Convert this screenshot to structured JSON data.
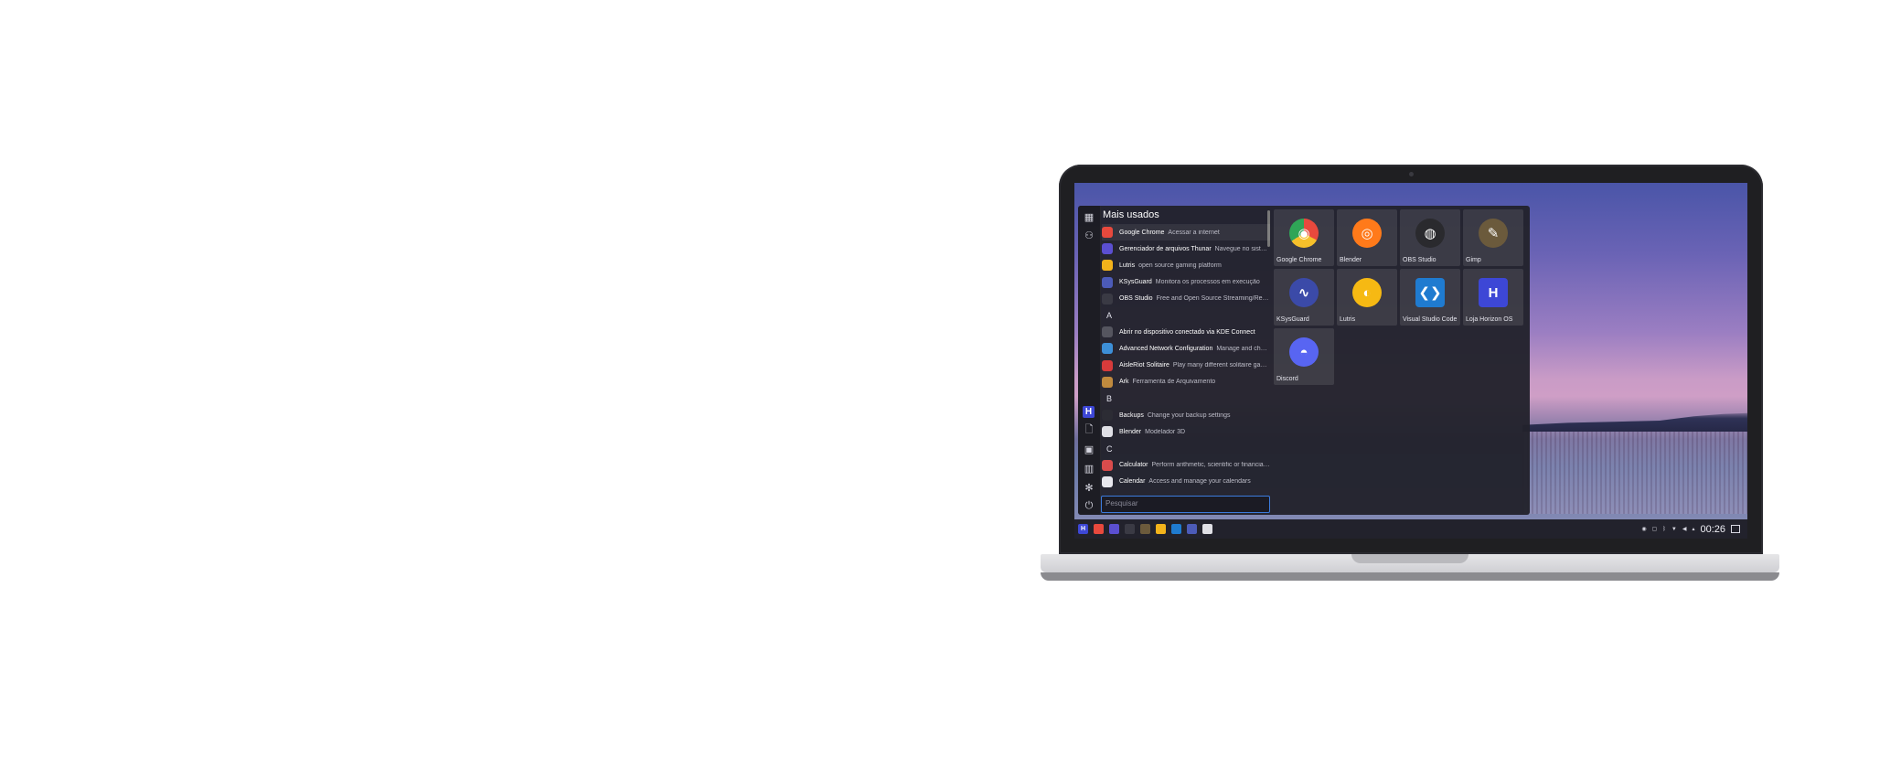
{
  "launcher": {
    "section_title": "Mais usados",
    "search_placeholder": "Pesquisar",
    "rows": [
      {
        "type": "app",
        "name": "Google Chrome",
        "desc": "Acessar a internet",
        "icon": "chrome-icon",
        "color": "#e8493d"
      },
      {
        "type": "app",
        "name": "Gerenciador de arquivos Thunar",
        "desc": "Navegue no sistema de arquivos",
        "icon": "folder-icon",
        "color": "#5b4fd1"
      },
      {
        "type": "app",
        "name": "Lutris",
        "desc": "open source gaming platform",
        "icon": "lutris-icon",
        "color": "#f3b31b"
      },
      {
        "type": "app",
        "name": "KSysGuard",
        "desc": "Monitora os processos em execução",
        "icon": "ksysguard-icon",
        "color": "#4c5bb8"
      },
      {
        "type": "app",
        "name": "OBS Studio",
        "desc": "Free and Open Source Streaming/Recording",
        "icon": "obs-icon",
        "color": "#3a3a44"
      },
      {
        "type": "letter",
        "name": "A"
      },
      {
        "type": "app",
        "name": "Abrir no dispositivo conectado via KDE Connect",
        "desc": "",
        "icon": "kdeconnect-icon",
        "color": "#55555f"
      },
      {
        "type": "app",
        "name": "Advanced Network Configuration",
        "desc": "Manage and change network connections",
        "icon": "network-icon",
        "color": "#3d8fd8"
      },
      {
        "type": "app",
        "name": "AisleRiot Solitaire",
        "desc": "Play many different solitaire games",
        "icon": "cards-icon",
        "color": "#d73b3b"
      },
      {
        "type": "app",
        "name": "Ark",
        "desc": "Ferramenta de Arquivamento",
        "icon": "ark-icon",
        "color": "#c08a3e"
      },
      {
        "type": "letter",
        "name": "B"
      },
      {
        "type": "app",
        "name": "Backups",
        "desc": "Change your backup settings",
        "icon": "backups-icon",
        "color": "#2c2c34"
      },
      {
        "type": "app",
        "name": "Blender",
        "desc": "Modelador 3D",
        "icon": "blender-icon",
        "color": "#e0e0e6"
      },
      {
        "type": "letter",
        "name": "C"
      },
      {
        "type": "app",
        "name": "Calculator",
        "desc": "Perform arithmetic, scientific or financial calculations",
        "icon": "calculator-icon",
        "color": "#d94c4c"
      },
      {
        "type": "app",
        "name": "Calendar",
        "desc": "Access and manage your calendars",
        "icon": "calendar-icon",
        "color": "#e8e8ee"
      }
    ],
    "tiles": [
      {
        "label": "Google Chrome",
        "icon": "chrome-icon",
        "color": "#ffffff"
      },
      {
        "label": "Blender",
        "icon": "blender-icon",
        "color": "#ff7a1a"
      },
      {
        "label": "OBS Studio",
        "icon": "obs-icon",
        "color": "#2a2a2e"
      },
      {
        "label": "Gimp",
        "icon": "gimp-icon",
        "color": "#6b5a3c"
      },
      {
        "label": "KSysGuard",
        "icon": "ksysguard-icon",
        "color": "#3b4aa8"
      },
      {
        "label": "Lutris",
        "icon": "lutris-icon",
        "color": "#f6b913"
      },
      {
        "label": "Visual Studio Code",
        "icon": "vscode-icon",
        "color": "#1f7bd0"
      },
      {
        "label": "Loja Horizon OS",
        "icon": "store-icon",
        "color": "#3d47d6"
      },
      {
        "label": "Discord",
        "icon": "discord-icon",
        "color": "#5865f2"
      }
    ],
    "rail": [
      "apps-icon",
      "people-icon",
      "horizon-logo-icon",
      "document-icon",
      "image-icon",
      "chart-icon",
      "settings-icon",
      "power-icon"
    ]
  },
  "taskbar": {
    "logo": "H",
    "clock": "00:26",
    "apps": [
      "horizon-logo-icon",
      "chrome-icon",
      "folder-icon",
      "obs-icon",
      "gimp-icon",
      "lutris-icon",
      "vscode-icon",
      "ksysguard-icon",
      "kdeconnect-icon"
    ],
    "tray": [
      "network-icon",
      "clipboard-icon",
      "bluetooth-icon",
      "wifi-icon",
      "volume-icon",
      "expand-icon",
      "desktop-icon"
    ]
  },
  "colors": {
    "accent": "#3d47d6",
    "search_border": "#3c7bdd",
    "panel": "#22222c"
  }
}
